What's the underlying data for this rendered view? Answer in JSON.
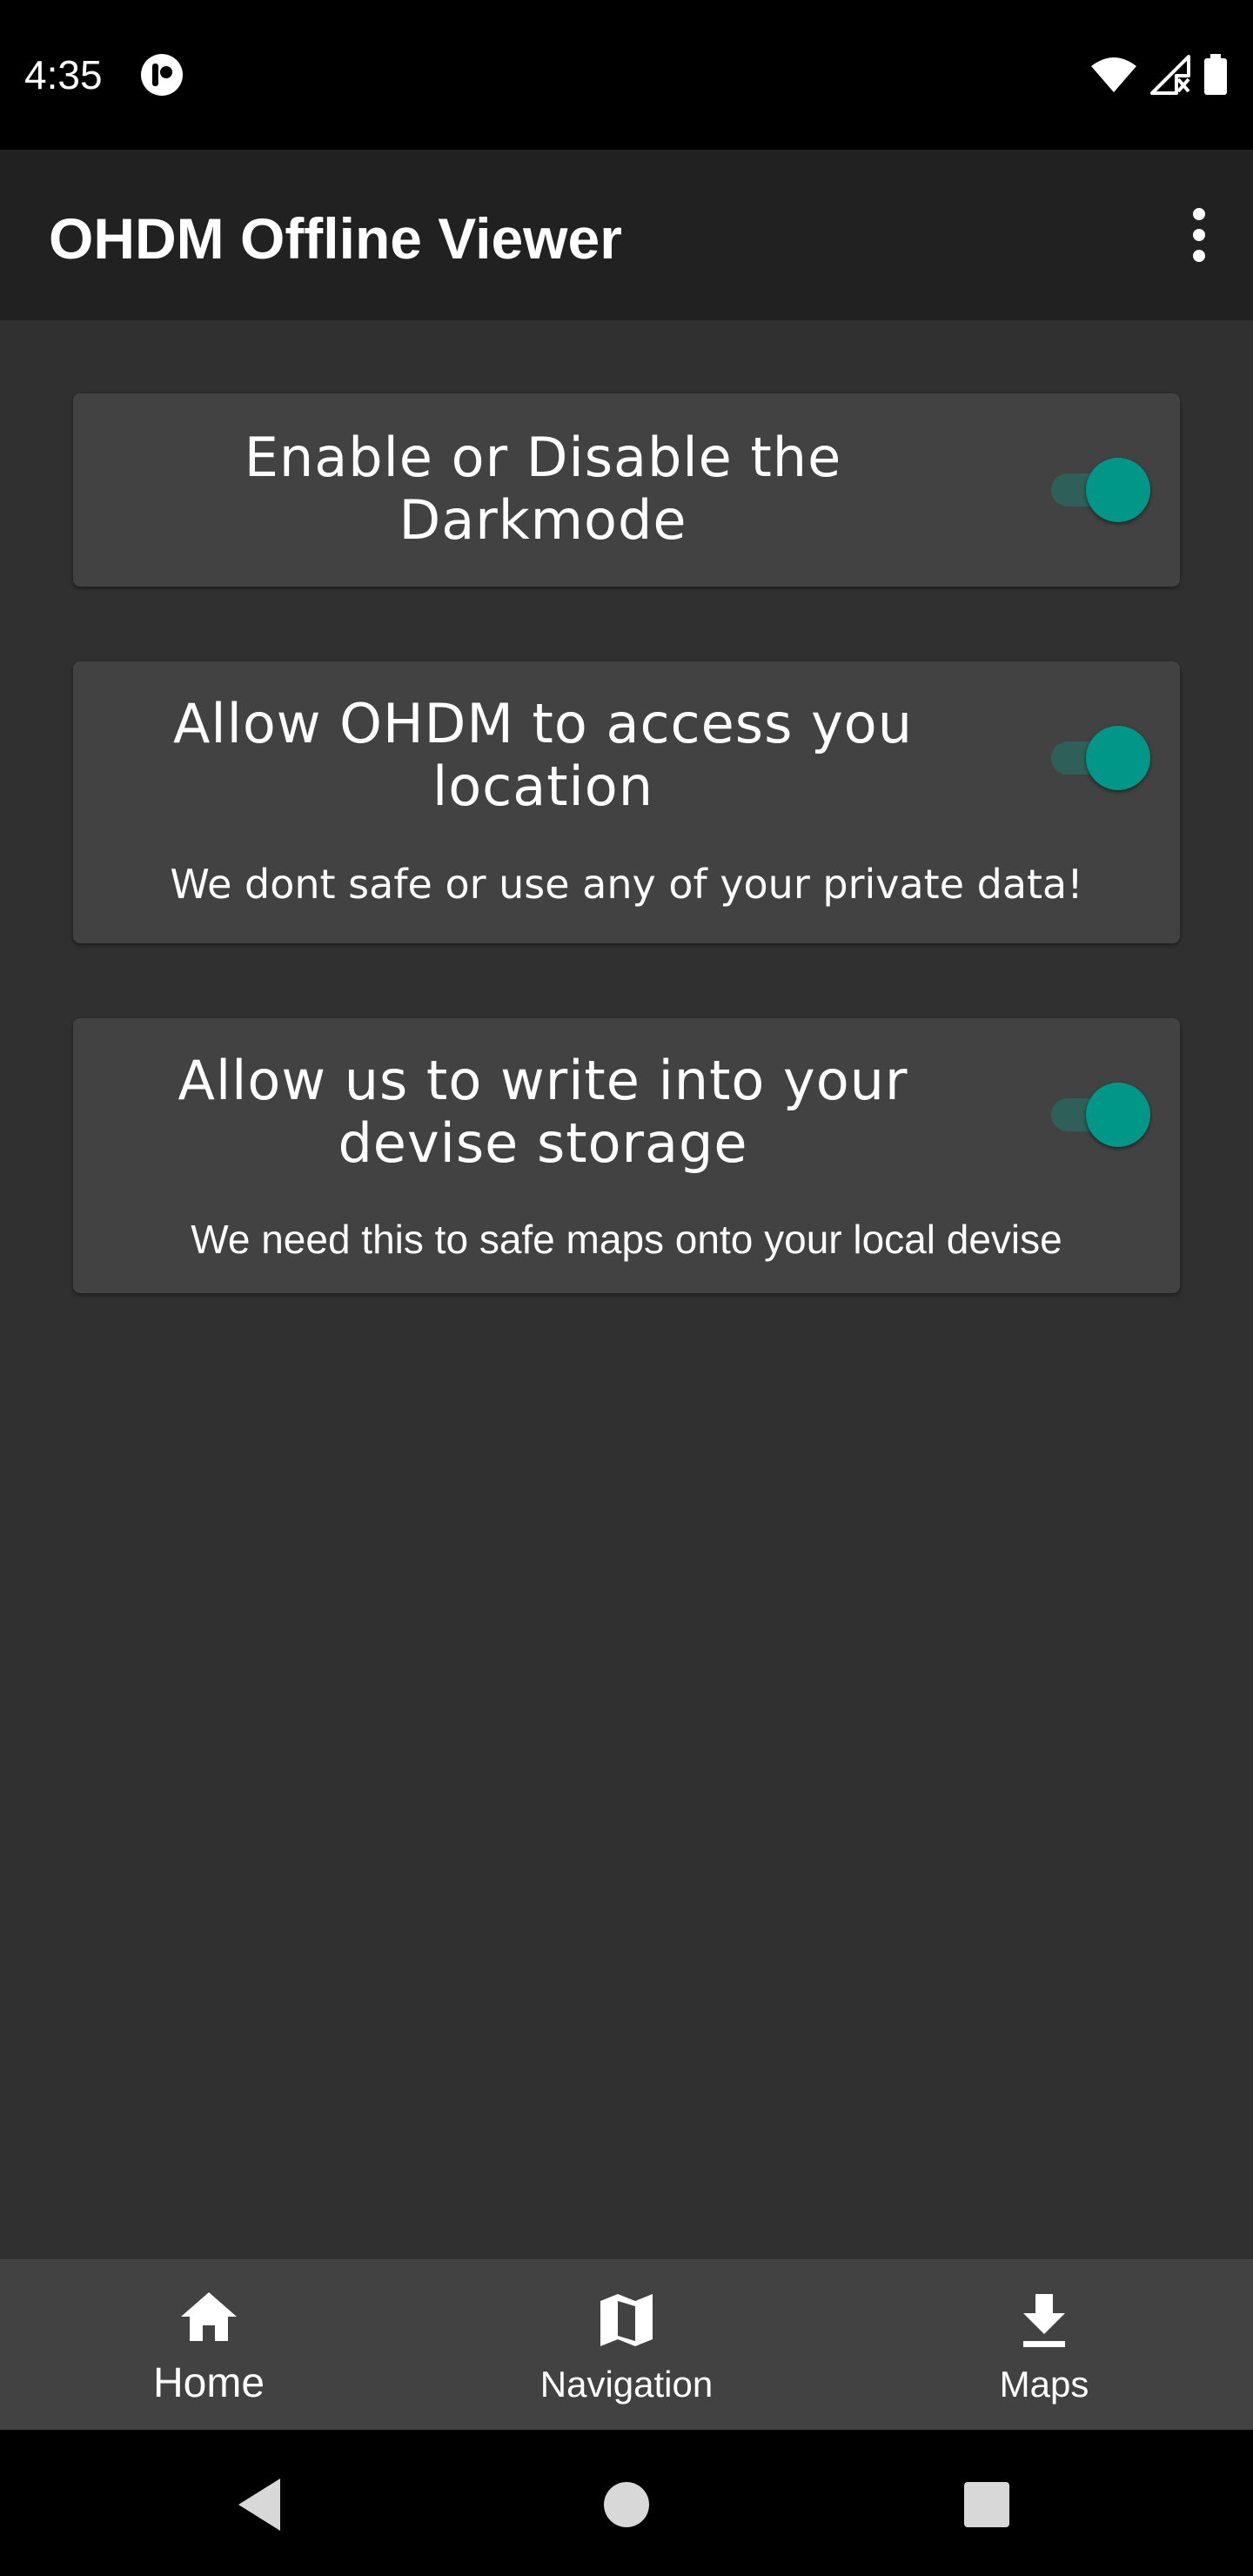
{
  "status_bar": {
    "time": "4:35",
    "app_icon": "app-notification-icon",
    "icons": [
      "wifi-icon",
      "signal-no-data-icon",
      "battery-icon"
    ]
  },
  "app_bar": {
    "title": "OHDM Offline Viewer",
    "menu_icon": "more-vert-icon"
  },
  "settings": [
    {
      "title_line1": "Enable or Disable the",
      "title_line2": "Darkmode",
      "subtitle": "",
      "enabled": true
    },
    {
      "title_line1": "Allow OHDM to access you",
      "title_line2": "location",
      "subtitle": "We dont safe or use any of your private data!",
      "enabled": true
    },
    {
      "title_line1": "Allow us to write into your",
      "title_line2": "devise storage",
      "subtitle": "We need this to safe maps onto your local devise",
      "enabled": true
    }
  ],
  "bottom_nav": {
    "items": [
      {
        "label": "Home",
        "icon": "home-icon",
        "active": true
      },
      {
        "label": "Navigation",
        "icon": "map-icon",
        "active": false
      },
      {
        "label": "Maps",
        "icon": "download-icon",
        "active": false
      }
    ]
  },
  "system_nav": {
    "icons": [
      "back-icon",
      "home-circle-icon",
      "recents-icon"
    ]
  },
  "colors": {
    "background": "#303030",
    "card": "#424242",
    "app_bar": "#212121",
    "accent": "#009688",
    "bottom_nav": "#424242"
  }
}
